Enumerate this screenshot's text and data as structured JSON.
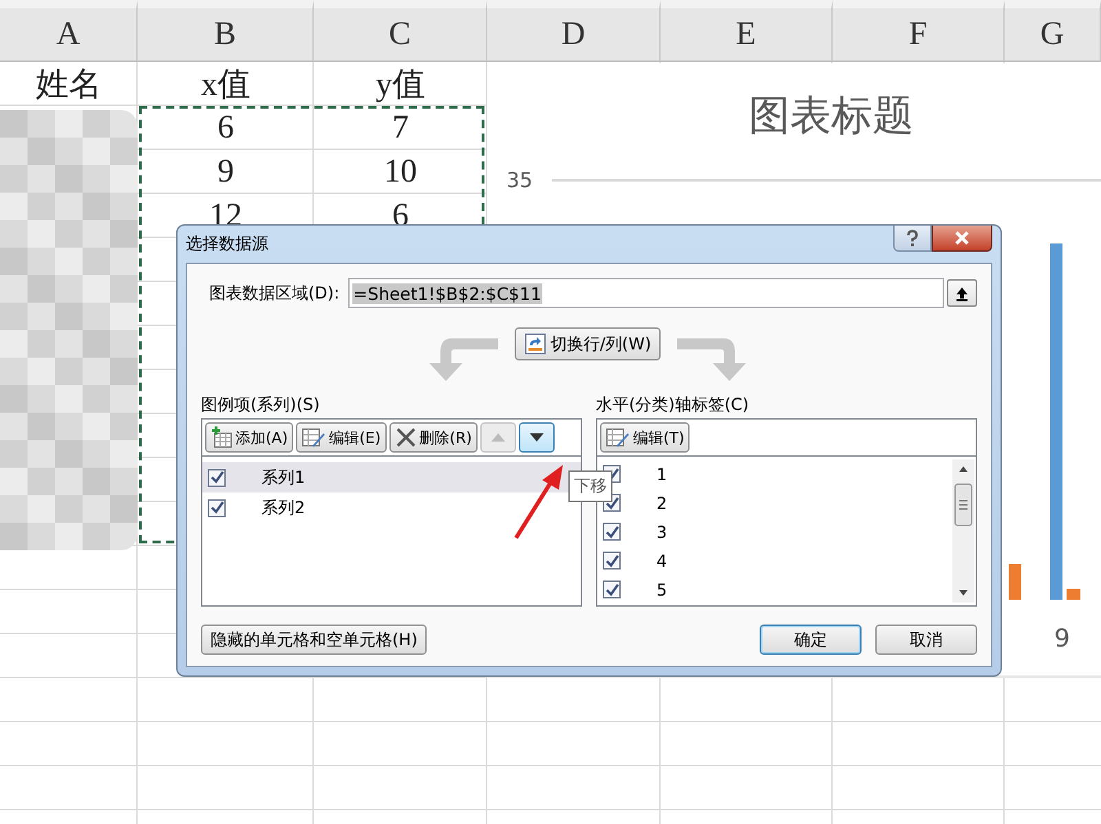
{
  "sheet": {
    "columns": [
      "A",
      "B",
      "C",
      "D",
      "E",
      "F",
      "G"
    ],
    "rows": [
      {
        "a": "姓名",
        "b": "x值",
        "c": "y值"
      },
      {
        "b": "6",
        "c": "7"
      },
      {
        "b": "9",
        "c": "10"
      },
      {
        "b": "12",
        "c": "6"
      }
    ]
  },
  "chart": {
    "title": "图表标题",
    "y_tick": "35",
    "x_label": "9"
  },
  "dialog": {
    "title": "选择数据源",
    "range_label": "图表数据区域(D):",
    "range_value": "=Sheet1!$B$2:$C$11",
    "switch_button": "切换行/列(W)",
    "series_panel": {
      "label": "图例项(系列)(S)",
      "buttons": [
        {
          "kind": "add",
          "label": "添加(A)",
          "disabled": false,
          "hovered": false
        },
        {
          "kind": "edit",
          "label": "编辑(E)",
          "disabled": false,
          "hovered": false
        },
        {
          "kind": "delete",
          "label": "删除(R)",
          "disabled": false,
          "hovered": false
        },
        {
          "kind": "up",
          "disabled": true,
          "hovered": false
        },
        {
          "kind": "down",
          "disabled": false,
          "hovered": true
        }
      ],
      "items": [
        {
          "label": "系列1",
          "checked": true,
          "selected": true
        },
        {
          "label": "系列2",
          "checked": true,
          "selected": false
        }
      ]
    },
    "tooltip": "下移",
    "axis_panel": {
      "label": "水平(分类)轴标签(C)",
      "edit_button": "编辑(T)",
      "items": [
        {
          "label": "1",
          "checked": true
        },
        {
          "label": "2",
          "checked": true
        },
        {
          "label": "3",
          "checked": true
        },
        {
          "label": "4",
          "checked": true
        },
        {
          "label": "5",
          "checked": true
        }
      ]
    },
    "hidden_cells_button": "隐藏的单元格和空单元格(H)",
    "ok_button": "确定",
    "cancel_button": "取消"
  }
}
